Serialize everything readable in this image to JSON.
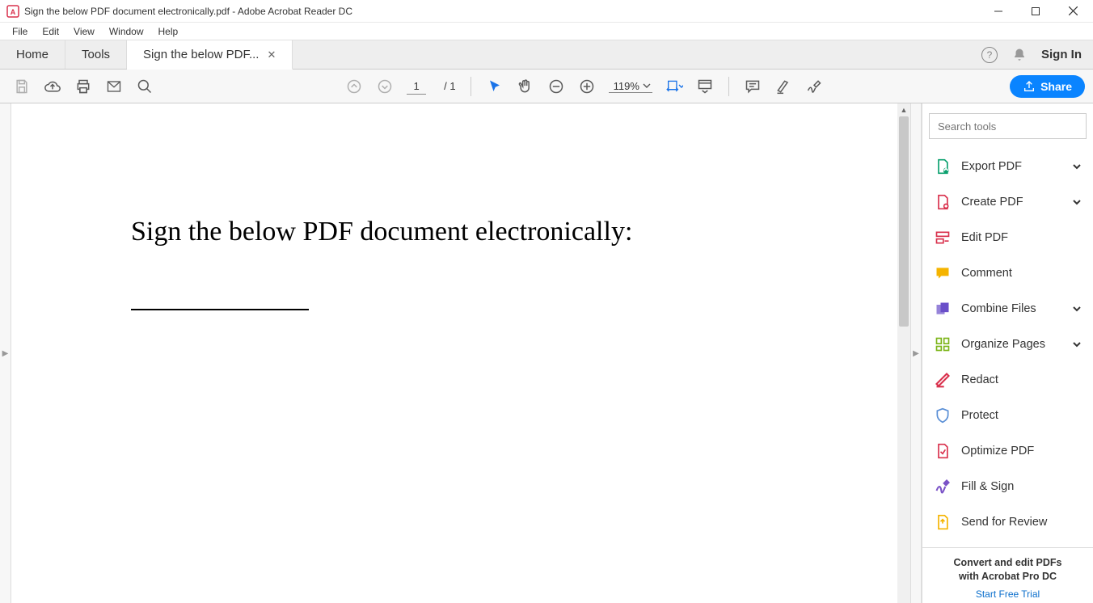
{
  "window": {
    "title": "Sign the below PDF document electronically.pdf - Adobe Acrobat Reader DC"
  },
  "menu": [
    "File",
    "Edit",
    "View",
    "Window",
    "Help"
  ],
  "tabs": {
    "home": "Home",
    "tools": "Tools",
    "document": "Sign the below PDF..."
  },
  "header": {
    "sign_in": "Sign In"
  },
  "toolbar": {
    "page_current": "1",
    "page_total": "/ 1",
    "zoom": "119%",
    "share_label": "Share"
  },
  "document": {
    "heading": "Sign the below PDF document electronically:"
  },
  "right_panel": {
    "search_placeholder": "Search tools",
    "tools": [
      {
        "label": "Export PDF",
        "expandable": true,
        "color": "#0aa06e"
      },
      {
        "label": "Create PDF",
        "expandable": true,
        "color": "#d9304c"
      },
      {
        "label": "Edit PDF",
        "expandable": false,
        "color": "#d9304c"
      },
      {
        "label": "Comment",
        "expandable": false,
        "color": "#f5b400"
      },
      {
        "label": "Combine Files",
        "expandable": true,
        "color": "#6a4fc9"
      },
      {
        "label": "Organize Pages",
        "expandable": true,
        "color": "#7cb518"
      },
      {
        "label": "Redact",
        "expandable": false,
        "color": "#d9304c"
      },
      {
        "label": "Protect",
        "expandable": false,
        "color": "#5a8fd6"
      },
      {
        "label": "Optimize PDF",
        "expandable": false,
        "color": "#d9304c"
      },
      {
        "label": "Fill & Sign",
        "expandable": false,
        "color": "#7a52c7"
      },
      {
        "label": "Send for Review",
        "expandable": false,
        "color": "#f5b400"
      }
    ],
    "promo_line1": "Convert and edit PDFs",
    "promo_line2": "with Acrobat Pro DC",
    "promo_link": "Start Free Trial"
  }
}
